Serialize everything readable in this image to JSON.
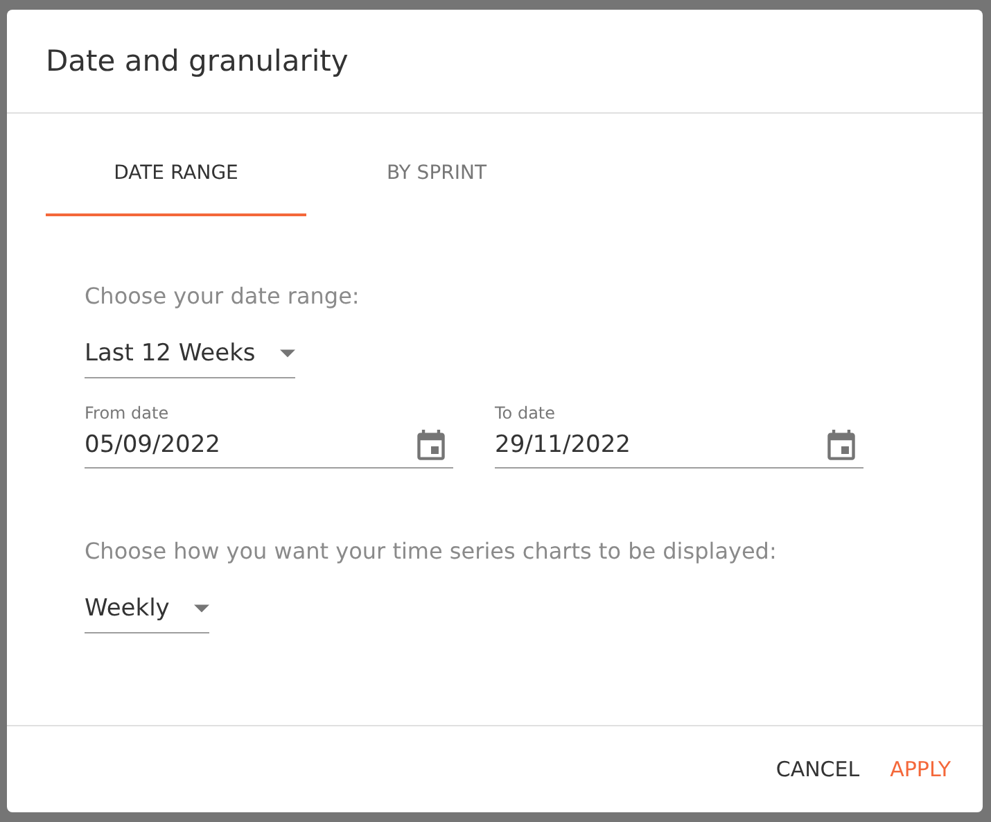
{
  "dialog": {
    "title": "Date and granularity"
  },
  "tabs": [
    {
      "label": "DATE RANGE",
      "selected": true
    },
    {
      "label": "BY SPRINT",
      "selected": false
    }
  ],
  "range_prompt": "Choose your date range:",
  "range_select": {
    "value": "Last 12 Weeks"
  },
  "date_fields": [
    {
      "label": "From date",
      "value": "05/09/2022"
    },
    {
      "label": "To date",
      "value": "29/11/2022"
    }
  ],
  "granularity_prompt": "Choose how you want your time series charts to be displayed:",
  "granularity_select": {
    "value": "Weekly"
  },
  "buttons": [
    {
      "label": "CANCEL",
      "kind": "secondary"
    },
    {
      "label": "APPLY",
      "kind": "primary"
    }
  ]
}
